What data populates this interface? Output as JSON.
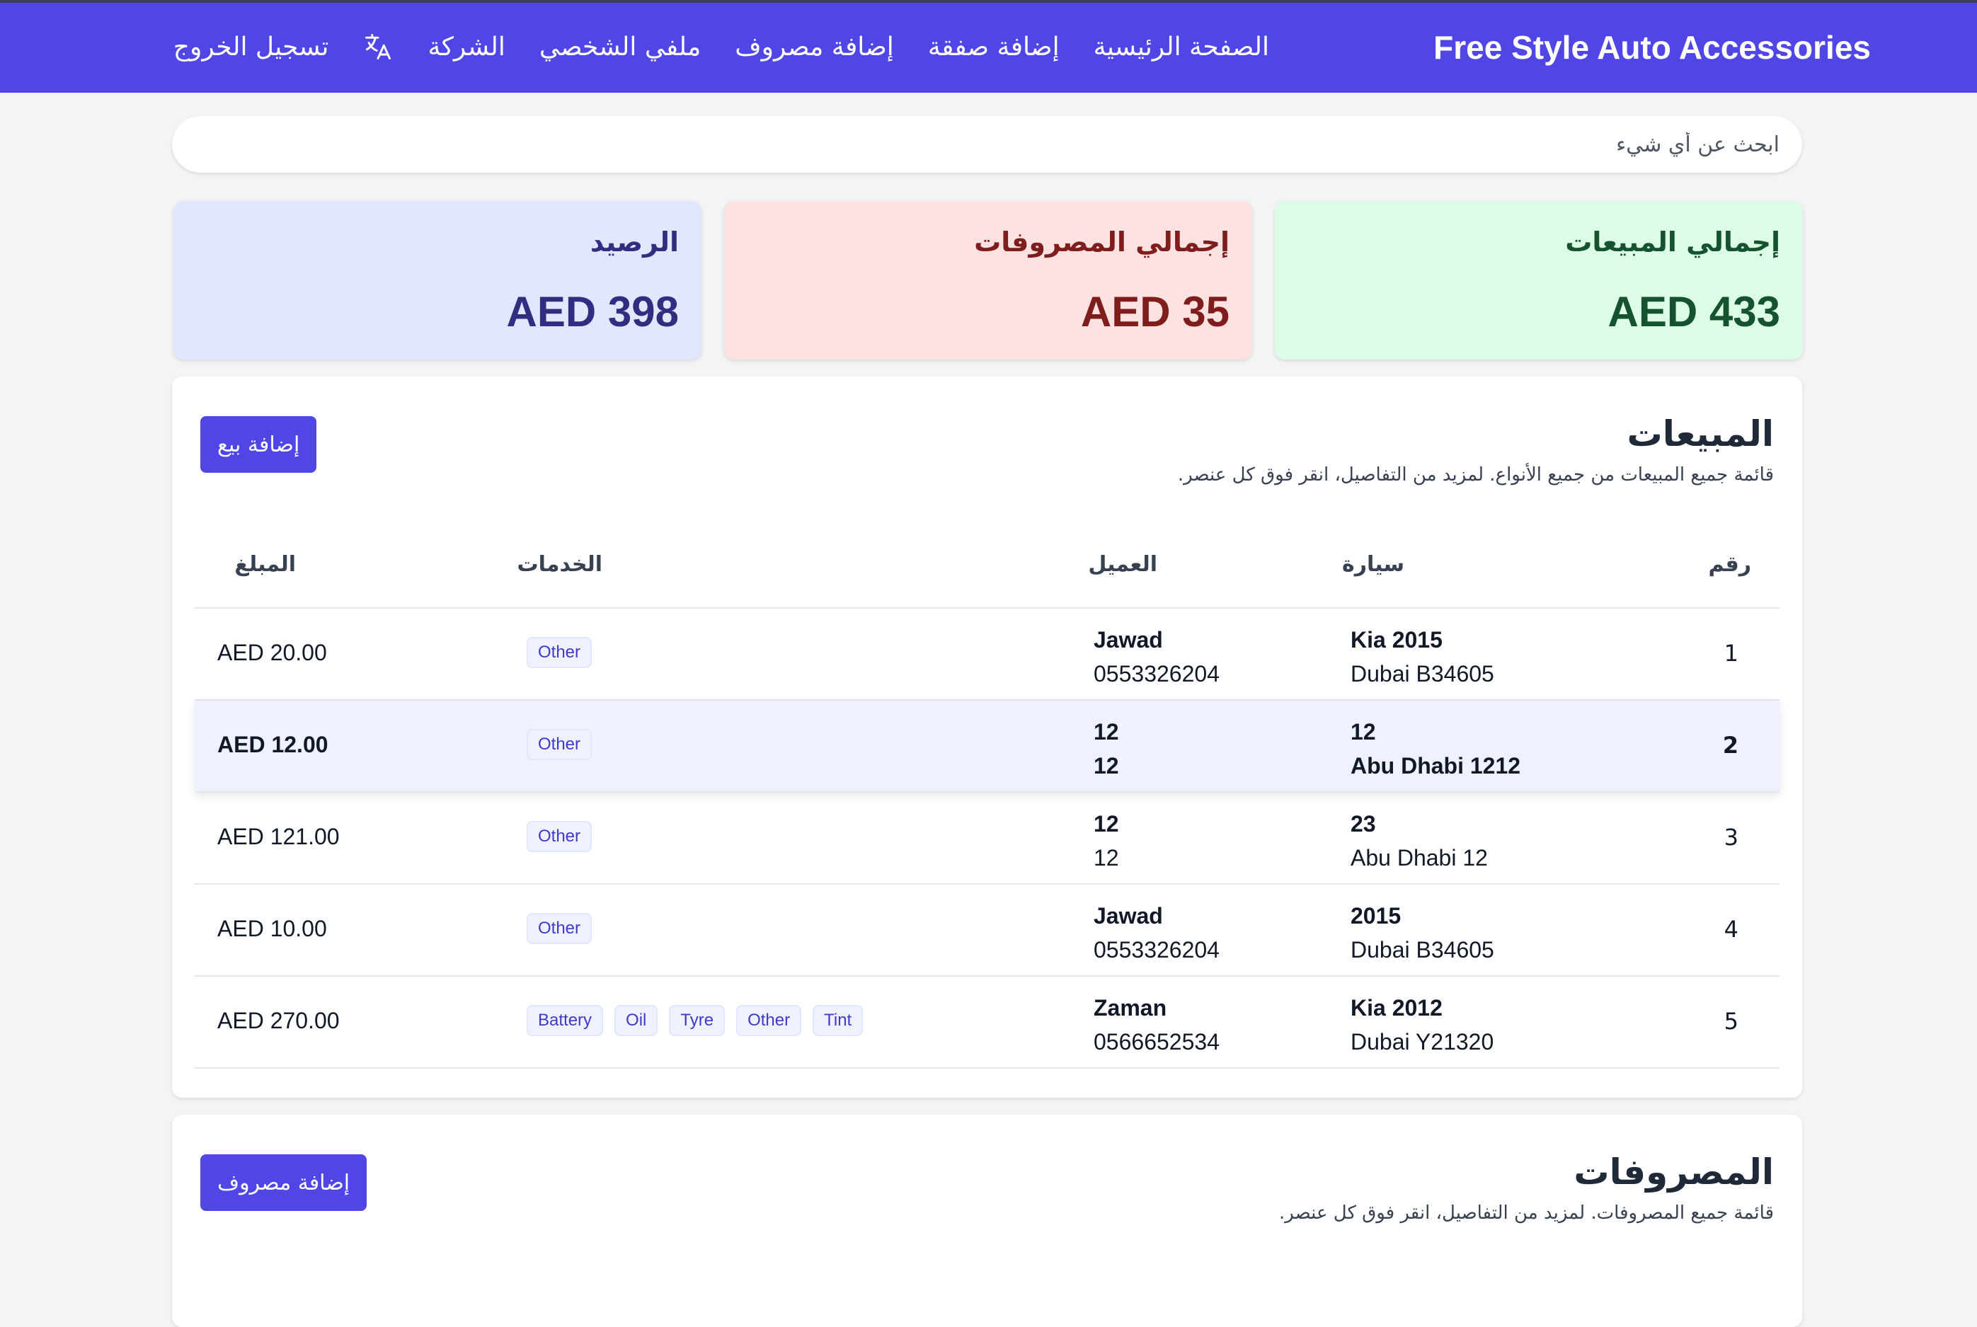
{
  "nav": {
    "brand": "Free Style Auto Accessories",
    "links": {
      "home": "الصفحة الرئيسية",
      "add_deal": "إضافة صفقة",
      "add_expense": "إضافة مصروف",
      "profile": "ملفي الشخصي",
      "company": "الشركة",
      "logout": "تسجيل الخروج"
    },
    "language_icon": "translate-icon"
  },
  "search": {
    "placeholder": "ابحث عن أي شيء",
    "value": ""
  },
  "stats": {
    "sales": {
      "title": "إجمالي المبيعات",
      "value": "AED 433"
    },
    "expenses": {
      "title": "إجمالي المصروفات",
      "value": "AED 35"
    },
    "balance": {
      "title": "الرصيد",
      "value": "AED 398"
    }
  },
  "sales_panel": {
    "title": "المبيعات",
    "subtitle": "قائمة جميع المبيعات من جميع الأنواع. لمزيد من التفاصيل، انقر فوق كل عنصر.",
    "add_button": "إضافة بيع",
    "columns": {
      "number": "رقم",
      "car": "سيارة",
      "customer": "العميل",
      "services": "الخدمات",
      "amount": "المبلغ"
    },
    "rows": [
      {
        "number": "1",
        "car_name": "Kia 2015",
        "car_plate": "Dubai B34605",
        "customer_name": "Jawad",
        "customer_phone": "0553326204",
        "services": [
          "Other"
        ],
        "amount": "AED 20.00"
      },
      {
        "number": "2",
        "car_name": "12",
        "car_plate": "Abu Dhabi 1212",
        "customer_name": "12",
        "customer_phone": "12",
        "services": [
          "Other"
        ],
        "amount": "AED 12.00"
      },
      {
        "number": "3",
        "car_name": "23",
        "car_plate": "Abu Dhabi 12",
        "customer_name": "12",
        "customer_phone": "12",
        "services": [
          "Other"
        ],
        "amount": "AED 121.00"
      },
      {
        "number": "4",
        "car_name": "2015",
        "car_plate": "Dubai B34605",
        "customer_name": "Jawad",
        "customer_phone": "0553326204",
        "services": [
          "Other"
        ],
        "amount": "AED 10.00"
      },
      {
        "number": "5",
        "car_name": "Kia 2012",
        "car_plate": "Dubai Y21320",
        "customer_name": "Zaman",
        "customer_phone": "0566652534",
        "services": [
          "Battery",
          "Oil",
          "Tyre",
          "Other",
          "Tint"
        ],
        "amount": "AED 270.00"
      }
    ]
  },
  "expenses_panel": {
    "title": "المصروفات",
    "subtitle": "قائمة جميع المصروفات. لمزيد من التفاصيل، انقر فوق كل عنصر.",
    "add_button": "إضافة مصروف"
  },
  "colors": {
    "primary": "#4f46e5",
    "sales_card": "#dcfce7",
    "expense_card": "#fee2e2",
    "balance_card": "#e0e7ff"
  }
}
